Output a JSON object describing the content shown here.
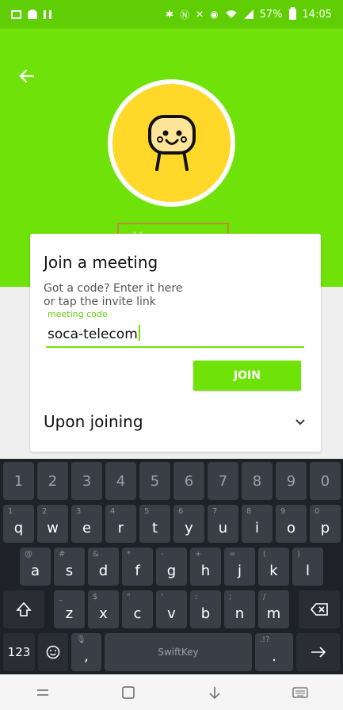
{
  "status_bar": {
    "battery": "57%",
    "time": "14:05"
  },
  "profile": {
    "name_placeholder": "Your name"
  },
  "card": {
    "title": "Join a meeting",
    "subtitle_line1": "Got a code? Enter it here",
    "subtitle_line2": "or tap the invite link",
    "code_label": "meeting code",
    "code_value": "soca-telecom",
    "join_label": "JOIN",
    "upon_joining_label": "Upon joining"
  },
  "keyboard": {
    "numbers": [
      "1",
      "2",
      "3",
      "4",
      "5",
      "6",
      "7",
      "8",
      "9",
      "0"
    ],
    "row1": [
      [
        "q",
        "1"
      ],
      [
        "w",
        "2"
      ],
      [
        "e",
        "3"
      ],
      [
        "r",
        "4"
      ],
      [
        "t",
        "5"
      ],
      [
        "y",
        "6"
      ],
      [
        "u",
        "7"
      ],
      [
        "i",
        "8"
      ],
      [
        "o",
        "9"
      ],
      [
        "p",
        "0"
      ]
    ],
    "row2": [
      [
        "a",
        "@"
      ],
      [
        "s",
        "#"
      ],
      [
        "d",
        "&"
      ],
      [
        "f",
        "*"
      ],
      [
        "g",
        "-"
      ],
      [
        "h",
        "+"
      ],
      [
        "j",
        "="
      ],
      [
        "k",
        "("
      ],
      [
        "l",
        ")"
      ]
    ],
    "row3": [
      [
        "z",
        "_"
      ],
      [
        "x",
        "$"
      ],
      [
        "c",
        "\""
      ],
      [
        "v",
        "'"
      ],
      [
        "b",
        ":"
      ],
      [
        "n",
        ";"
      ],
      [
        "m",
        "/"
      ]
    ],
    "symbols_label": "123",
    "comma_label": ",",
    "space_label": "SwiftKey",
    "period_label": ".",
    "period_hint": ".!?"
  },
  "colors": {
    "green": "#6fe309",
    "status_green": "#5fce05",
    "avatar": "#ffd82a",
    "keyboard": "#1e2126"
  }
}
